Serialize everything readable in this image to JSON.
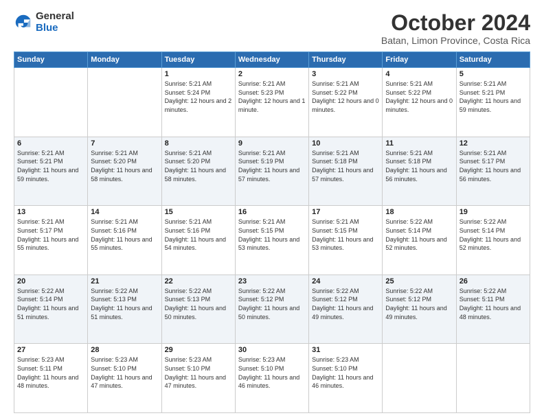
{
  "header": {
    "logo_general": "General",
    "logo_blue": "Blue",
    "month_title": "October 2024",
    "location": "Batan, Limon Province, Costa Rica"
  },
  "weekdays": [
    "Sunday",
    "Monday",
    "Tuesday",
    "Wednesday",
    "Thursday",
    "Friday",
    "Saturday"
  ],
  "weeks": [
    [
      {
        "day": "",
        "sunrise": "",
        "sunset": "",
        "daylight": ""
      },
      {
        "day": "",
        "sunrise": "",
        "sunset": "",
        "daylight": ""
      },
      {
        "day": "1",
        "sunrise": "Sunrise: 5:21 AM",
        "sunset": "Sunset: 5:24 PM",
        "daylight": "Daylight: 12 hours and 2 minutes."
      },
      {
        "day": "2",
        "sunrise": "Sunrise: 5:21 AM",
        "sunset": "Sunset: 5:23 PM",
        "daylight": "Daylight: 12 hours and 1 minute."
      },
      {
        "day": "3",
        "sunrise": "Sunrise: 5:21 AM",
        "sunset": "Sunset: 5:22 PM",
        "daylight": "Daylight: 12 hours and 0 minutes."
      },
      {
        "day": "4",
        "sunrise": "Sunrise: 5:21 AM",
        "sunset": "Sunset: 5:22 PM",
        "daylight": "Daylight: 12 hours and 0 minutes."
      },
      {
        "day": "5",
        "sunrise": "Sunrise: 5:21 AM",
        "sunset": "Sunset: 5:21 PM",
        "daylight": "Daylight: 11 hours and 59 minutes."
      }
    ],
    [
      {
        "day": "6",
        "sunrise": "Sunrise: 5:21 AM",
        "sunset": "Sunset: 5:21 PM",
        "daylight": "Daylight: 11 hours and 59 minutes."
      },
      {
        "day": "7",
        "sunrise": "Sunrise: 5:21 AM",
        "sunset": "Sunset: 5:20 PM",
        "daylight": "Daylight: 11 hours and 58 minutes."
      },
      {
        "day": "8",
        "sunrise": "Sunrise: 5:21 AM",
        "sunset": "Sunset: 5:20 PM",
        "daylight": "Daylight: 11 hours and 58 minutes."
      },
      {
        "day": "9",
        "sunrise": "Sunrise: 5:21 AM",
        "sunset": "Sunset: 5:19 PM",
        "daylight": "Daylight: 11 hours and 57 minutes."
      },
      {
        "day": "10",
        "sunrise": "Sunrise: 5:21 AM",
        "sunset": "Sunset: 5:18 PM",
        "daylight": "Daylight: 11 hours and 57 minutes."
      },
      {
        "day": "11",
        "sunrise": "Sunrise: 5:21 AM",
        "sunset": "Sunset: 5:18 PM",
        "daylight": "Daylight: 11 hours and 56 minutes."
      },
      {
        "day": "12",
        "sunrise": "Sunrise: 5:21 AM",
        "sunset": "Sunset: 5:17 PM",
        "daylight": "Daylight: 11 hours and 56 minutes."
      }
    ],
    [
      {
        "day": "13",
        "sunrise": "Sunrise: 5:21 AM",
        "sunset": "Sunset: 5:17 PM",
        "daylight": "Daylight: 11 hours and 55 minutes."
      },
      {
        "day": "14",
        "sunrise": "Sunrise: 5:21 AM",
        "sunset": "Sunset: 5:16 PM",
        "daylight": "Daylight: 11 hours and 55 minutes."
      },
      {
        "day": "15",
        "sunrise": "Sunrise: 5:21 AM",
        "sunset": "Sunset: 5:16 PM",
        "daylight": "Daylight: 11 hours and 54 minutes."
      },
      {
        "day": "16",
        "sunrise": "Sunrise: 5:21 AM",
        "sunset": "Sunset: 5:15 PM",
        "daylight": "Daylight: 11 hours and 53 minutes."
      },
      {
        "day": "17",
        "sunrise": "Sunrise: 5:21 AM",
        "sunset": "Sunset: 5:15 PM",
        "daylight": "Daylight: 11 hours and 53 minutes."
      },
      {
        "day": "18",
        "sunrise": "Sunrise: 5:22 AM",
        "sunset": "Sunset: 5:14 PM",
        "daylight": "Daylight: 11 hours and 52 minutes."
      },
      {
        "day": "19",
        "sunrise": "Sunrise: 5:22 AM",
        "sunset": "Sunset: 5:14 PM",
        "daylight": "Daylight: 11 hours and 52 minutes."
      }
    ],
    [
      {
        "day": "20",
        "sunrise": "Sunrise: 5:22 AM",
        "sunset": "Sunset: 5:14 PM",
        "daylight": "Daylight: 11 hours and 51 minutes."
      },
      {
        "day": "21",
        "sunrise": "Sunrise: 5:22 AM",
        "sunset": "Sunset: 5:13 PM",
        "daylight": "Daylight: 11 hours and 51 minutes."
      },
      {
        "day": "22",
        "sunrise": "Sunrise: 5:22 AM",
        "sunset": "Sunset: 5:13 PM",
        "daylight": "Daylight: 11 hours and 50 minutes."
      },
      {
        "day": "23",
        "sunrise": "Sunrise: 5:22 AM",
        "sunset": "Sunset: 5:12 PM",
        "daylight": "Daylight: 11 hours and 50 minutes."
      },
      {
        "day": "24",
        "sunrise": "Sunrise: 5:22 AM",
        "sunset": "Sunset: 5:12 PM",
        "daylight": "Daylight: 11 hours and 49 minutes."
      },
      {
        "day": "25",
        "sunrise": "Sunrise: 5:22 AM",
        "sunset": "Sunset: 5:12 PM",
        "daylight": "Daylight: 11 hours and 49 minutes."
      },
      {
        "day": "26",
        "sunrise": "Sunrise: 5:22 AM",
        "sunset": "Sunset: 5:11 PM",
        "daylight": "Daylight: 11 hours and 48 minutes."
      }
    ],
    [
      {
        "day": "27",
        "sunrise": "Sunrise: 5:23 AM",
        "sunset": "Sunset: 5:11 PM",
        "daylight": "Daylight: 11 hours and 48 minutes."
      },
      {
        "day": "28",
        "sunrise": "Sunrise: 5:23 AM",
        "sunset": "Sunset: 5:10 PM",
        "daylight": "Daylight: 11 hours and 47 minutes."
      },
      {
        "day": "29",
        "sunrise": "Sunrise: 5:23 AM",
        "sunset": "Sunset: 5:10 PM",
        "daylight": "Daylight: 11 hours and 47 minutes."
      },
      {
        "day": "30",
        "sunrise": "Sunrise: 5:23 AM",
        "sunset": "Sunset: 5:10 PM",
        "daylight": "Daylight: 11 hours and 46 minutes."
      },
      {
        "day": "31",
        "sunrise": "Sunrise: 5:23 AM",
        "sunset": "Sunset: 5:10 PM",
        "daylight": "Daylight: 11 hours and 46 minutes."
      },
      {
        "day": "",
        "sunrise": "",
        "sunset": "",
        "daylight": ""
      },
      {
        "day": "",
        "sunrise": "",
        "sunset": "",
        "daylight": ""
      }
    ]
  ]
}
